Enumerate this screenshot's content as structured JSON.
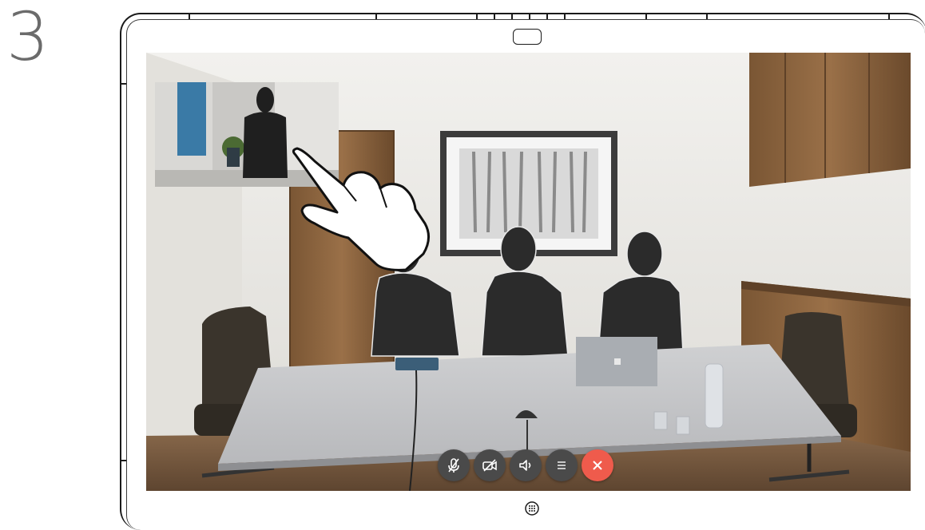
{
  "step": {
    "number": "3"
  },
  "call": {
    "controls": [
      {
        "id": "mute",
        "icon": "microphone-icon"
      },
      {
        "id": "video",
        "icon": "camera-off-icon"
      },
      {
        "id": "volume",
        "icon": "speaker-icon"
      },
      {
        "id": "more",
        "icon": "list-icon"
      },
      {
        "id": "end",
        "icon": "close-icon"
      }
    ],
    "end_call_color": "#ef5b4c",
    "button_color": "#4a4a4a"
  },
  "device": {
    "home_icon": "keypad-icon"
  }
}
